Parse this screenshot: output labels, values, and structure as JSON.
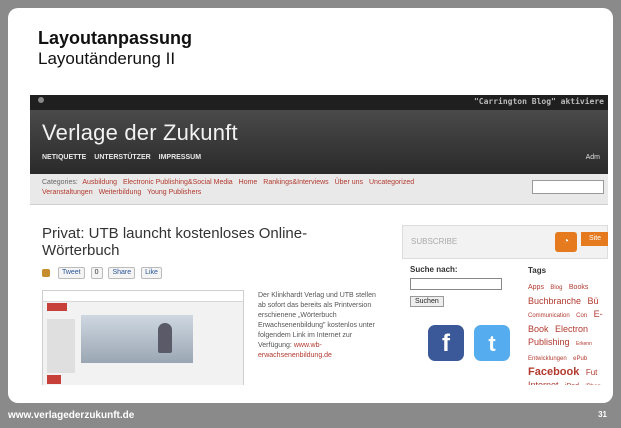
{
  "slide": {
    "title": "Layoutanpassung",
    "subtitle": "Layoutänderung II",
    "footer_url": "www.verlagederzukunft.de",
    "page_number": "31"
  },
  "screenshot": {
    "adminbar_notice": "\"Carrington Blog\" aktiviere",
    "site_title": "Verlage der Zukunft",
    "nav": [
      "NETIQUETTE",
      "UNTERSTÜTZER",
      "IMPRESSUM"
    ],
    "admin_short": "Adm",
    "categories_label": "Categories:",
    "categories_line1": [
      "Ausbildung",
      "Electronic Publishing&Social Media",
      "Home",
      "Rankings&Interviews",
      "Über uns",
      "Uncategorized"
    ],
    "categories_line2": [
      "Veranstaltungen",
      "Weiterbildung",
      "Young Publishers"
    ],
    "post_title": "Privat: UTB launcht kostenloses Online-Wörterbuch",
    "social": {
      "tweet": "Tweet",
      "count": "0",
      "share": "Share",
      "like": "Like"
    },
    "excerpt": "Der Klinkhardt Verlag und UTB stellen ab sofort das bereits als Printversion erschienene „Wörterbuch Erwachsenenbildung\" kostenlos unter folgendem Link im Internet zur Verfügung:",
    "excerpt_link": "www.wb-erwachsenenbildung.de",
    "subscribe_label": "SUBSCRIBE",
    "site_label": "Site",
    "search_heading": "Suche nach:",
    "search_button": "Suchen",
    "tags_heading": "Tags",
    "tags": [
      {
        "text": "Apps",
        "size": 7
      },
      {
        "text": "Blog",
        "size": 6
      },
      {
        "text": "Books",
        "size": 7
      },
      {
        "text": "Buchbranche",
        "size": 9
      },
      {
        "text": "Bü",
        "size": 9
      },
      {
        "text": "Communication",
        "size": 6
      },
      {
        "text": "Con",
        "size": 6
      },
      {
        "text": "E-Book",
        "size": 9
      },
      {
        "text": "Electron",
        "size": 9
      },
      {
        "text": "Publishing",
        "size": 9
      },
      {
        "text": "Erkenn",
        "size": 5
      },
      {
        "text": "Entwicklungen",
        "size": 6
      },
      {
        "text": "ePub",
        "size": 6
      },
      {
        "text": "Facebook",
        "size": 11
      },
      {
        "text": "Fut",
        "size": 8
      },
      {
        "text": "Internet",
        "size": 9
      },
      {
        "text": "iPad",
        "size": 7
      },
      {
        "text": "iPhon",
        "size": 6
      }
    ]
  }
}
